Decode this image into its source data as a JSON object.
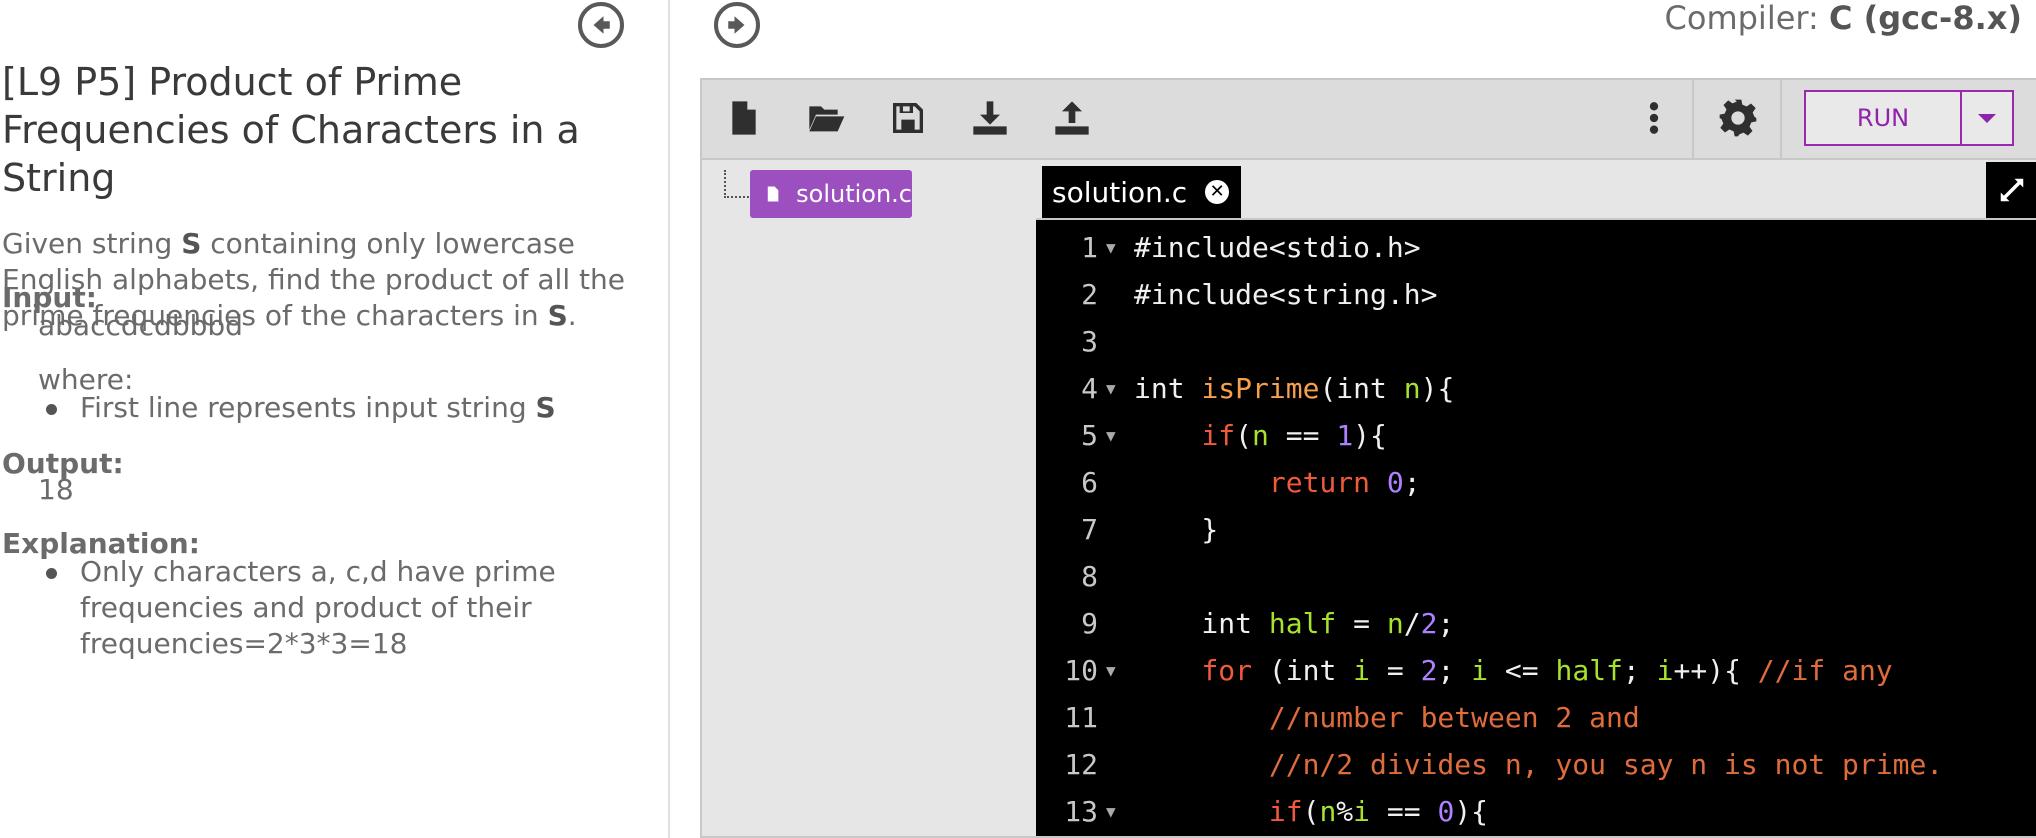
{
  "problem": {
    "title": "[L9 P5] Product of Prime Frequencies of Characters in a String",
    "desc_pre": "Given string ",
    "desc_s1": "S",
    "desc_mid": " containing only lowercase English alphabets, find the product of all the prime frequencies of the characters in ",
    "desc_s2": "S",
    "desc_end": ".",
    "input_label": "Input:",
    "input_value": "abaccdcdbbbd",
    "where_label": "where:",
    "where_item_pre": "First line represents input string ",
    "where_item_s": "S",
    "output_label": "Output:",
    "output_value": "18",
    "explanation_label": "Explanation:",
    "explanation_item": "Only characters a, c,d have prime frequencies and product of their frequencies=2*3*3=18"
  },
  "compiler": {
    "label": "Compiler: ",
    "value": "C (gcc-8.x)"
  },
  "toolbar": {
    "icons": [
      "new-file-icon",
      "open-folder-icon",
      "save-icon",
      "download-icon",
      "upload-icon",
      "more-vert-icon",
      "settings-gear-icon"
    ],
    "run_label": "RUN"
  },
  "tree": {
    "file_name": "solution.c"
  },
  "editor": {
    "tab_name": "solution.c",
    "close_glyph": "✕",
    "lines": [
      {
        "n": "1",
        "fold": "▼"
      },
      {
        "n": "2",
        "fold": ""
      },
      {
        "n": "3",
        "fold": ""
      },
      {
        "n": "4",
        "fold": "▼"
      },
      {
        "n": "5",
        "fold": "▼"
      },
      {
        "n": "6",
        "fold": ""
      },
      {
        "n": "7",
        "fold": ""
      },
      {
        "n": "8",
        "fold": ""
      },
      {
        "n": "9",
        "fold": ""
      },
      {
        "n": "10",
        "fold": "▼"
      },
      {
        "n": "11",
        "fold": ""
      },
      {
        "n": "12",
        "fold": ""
      },
      {
        "n": "13",
        "fold": "▼"
      }
    ],
    "code": [
      [
        [
          "tp",
          "#include<stdio.h>"
        ]
      ],
      [
        [
          "tp",
          "#include<string.h>"
        ]
      ],
      [
        [
          "tp",
          ""
        ]
      ],
      [
        [
          "tp",
          "int "
        ],
        [
          "fn",
          "isPrime"
        ],
        [
          "tp",
          "(int "
        ],
        [
          "id",
          "n"
        ],
        [
          "tp",
          "){"
        ]
      ],
      [
        [
          "tp",
          "    "
        ],
        [
          "kw",
          "if"
        ],
        [
          "tp",
          "("
        ],
        [
          "id",
          "n"
        ],
        [
          "tp",
          " == "
        ],
        [
          "nm",
          "1"
        ],
        [
          "tp",
          "){"
        ]
      ],
      [
        [
          "tp",
          "        "
        ],
        [
          "kw",
          "return "
        ],
        [
          "nm",
          "0"
        ],
        [
          "tp",
          ";"
        ]
      ],
      [
        [
          "tp",
          "    }"
        ]
      ],
      [
        [
          "tp",
          ""
        ]
      ],
      [
        [
          "tp",
          "    int "
        ],
        [
          "id",
          "half"
        ],
        [
          "tp",
          " = "
        ],
        [
          "id",
          "n"
        ],
        [
          "tp",
          "/"
        ],
        [
          "nm",
          "2"
        ],
        [
          "tp",
          ";"
        ]
      ],
      [
        [
          "tp",
          "    "
        ],
        [
          "kw",
          "for "
        ],
        [
          "tp",
          "(int "
        ],
        [
          "id",
          "i"
        ],
        [
          "tp",
          " = "
        ],
        [
          "nm",
          "2"
        ],
        [
          "tp",
          "; "
        ],
        [
          "id",
          "i"
        ],
        [
          "tp",
          " <= "
        ],
        [
          "id",
          "half"
        ],
        [
          "tp",
          "; "
        ],
        [
          "id",
          "i"
        ],
        [
          "tp",
          "++){ "
        ],
        [
          "cm",
          "//if any"
        ]
      ],
      [
        [
          "tp",
          "        "
        ],
        [
          "cm",
          "//number between 2 and"
        ]
      ],
      [
        [
          "tp",
          "        "
        ],
        [
          "cm",
          "//n/2 divides n, you say n is not prime."
        ]
      ],
      [
        [
          "tp",
          "        "
        ],
        [
          "kw",
          "if"
        ],
        [
          "tp",
          "("
        ],
        [
          "id",
          "n"
        ],
        [
          "tp",
          "%"
        ],
        [
          "id",
          "i"
        ],
        [
          "tp",
          " == "
        ],
        [
          "nm",
          "0"
        ],
        [
          "tp",
          "){"
        ]
      ]
    ]
  }
}
